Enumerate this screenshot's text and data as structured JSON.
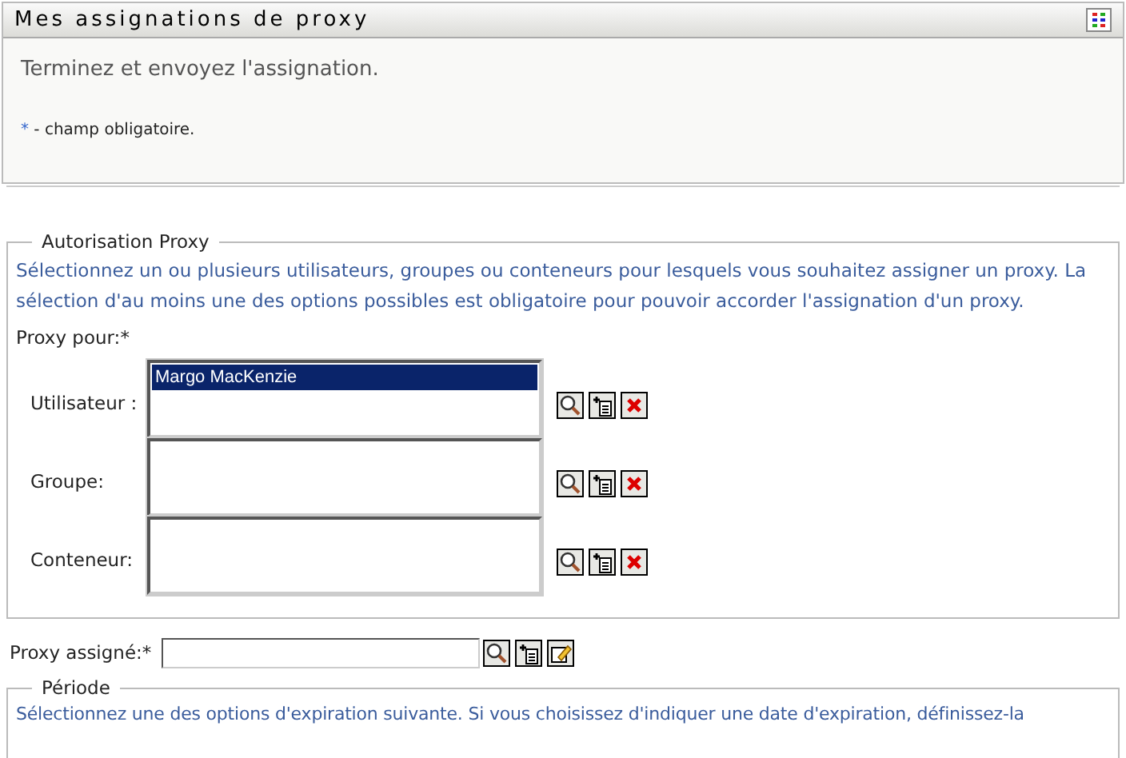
{
  "window": {
    "title": "Mes assignations de proxy"
  },
  "header": {
    "instruction": "Terminez et envoyez l'assignation.",
    "required_mark": "*",
    "required_note": " - champ obligatoire."
  },
  "authorization": {
    "legend": "Autorisation Proxy",
    "description": "Sélectionnez un ou plusieurs utilisateurs, groupes ou conteneurs pour lesquels vous souhaitez assigner un proxy. La sélection d'au moins une des options possibles est obligatoire pour pouvoir accorder l'assignation d'un proxy.",
    "proxy_for_label": "Proxy pour:",
    "proxy_for_mark": "*",
    "rows": [
      {
        "label": "Utilisateur :",
        "items": [
          {
            "text": "Margo MacKenzie",
            "selected": true
          }
        ],
        "actions": [
          {
            "kind": "search"
          },
          {
            "kind": "history"
          },
          {
            "kind": "delete"
          }
        ]
      },
      {
        "label": "Groupe:",
        "actions": [
          {
            "kind": "search"
          },
          {
            "kind": "history"
          },
          {
            "kind": "delete"
          }
        ]
      },
      {
        "label": "Conteneur:",
        "actions": [
          {
            "kind": "search"
          },
          {
            "kind": "history"
          },
          {
            "kind": "delete"
          }
        ]
      }
    ]
  },
  "assigned_proxy": {
    "label": "Proxy assigné:",
    "mark": "*",
    "actions": [
      {
        "kind": "search"
      },
      {
        "kind": "history"
      },
      {
        "kind": "edit"
      }
    ]
  },
  "period": {
    "legend": "Période",
    "description": "Sélectionnez une des options d'expiration suivante. Si vous choisissez d'indiquer une date d'expiration, définissez-la"
  }
}
